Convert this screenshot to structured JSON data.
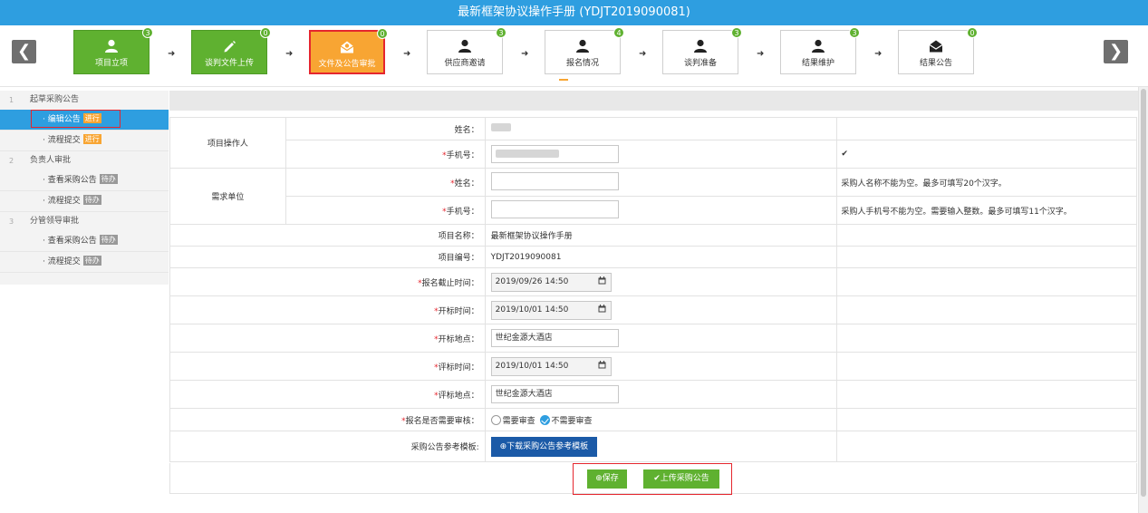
{
  "title": "最新框架协议操作手册 (YDJT2019090081)",
  "steps": [
    {
      "label": "项目立项",
      "count": "3",
      "icon": "user-icon",
      "state": "done"
    },
    {
      "label": "谈判文件上传",
      "count": "0",
      "icon": "pencil-icon",
      "state": "done"
    },
    {
      "label": "文件及公告审批",
      "count": "0",
      "icon": "envelope-open-icon",
      "state": "current"
    },
    {
      "label": "供应商邀请",
      "count": "3",
      "icon": "user-icon",
      "state": "todo"
    },
    {
      "label": "报名情况",
      "count": "4",
      "icon": "user-icon",
      "state": "todo"
    },
    {
      "label": "谈判准备",
      "count": "3",
      "icon": "user-icon",
      "state": "todo"
    },
    {
      "label": "结果维护",
      "count": "3",
      "icon": "user-icon",
      "state": "todo"
    },
    {
      "label": "结果公告",
      "count": "0",
      "icon": "envelope-icon",
      "state": "todo"
    }
  ],
  "sidebar": [
    {
      "num": "1",
      "label": "起草采购公告",
      "items": [
        {
          "label": "· 编辑公告",
          "status": "进行",
          "active": true
        },
        {
          "label": "· 流程提交",
          "status": "进行",
          "active": false
        }
      ]
    },
    {
      "num": "2",
      "label": "负责人审批",
      "items": [
        {
          "label": "· 查看采购公告",
          "status": "待办",
          "active": false
        },
        {
          "label": "· 流程提交",
          "status": "待办",
          "active": false
        }
      ]
    },
    {
      "num": "3",
      "label": "分管领导审批",
      "items": [
        {
          "label": "· 查看采购公告",
          "status": "待办",
          "active": false
        },
        {
          "label": "· 流程提交",
          "status": "待办",
          "active": false
        }
      ]
    }
  ],
  "form": {
    "operator_group": "项目操作人",
    "name_label": "姓名：",
    "phone_label": "手机号：",
    "phone_ok_mark": "✔",
    "demand_group": "需求单位",
    "demand_name_label": "姓名：",
    "demand_name_tip": "采购人名称不能为空。最多可填写20个汉字。",
    "demand_phone_label": "手机号：",
    "demand_phone_tip": "采购人手机号不能为空。需要输入整数。最多可填写11个汉字。",
    "project_name_label": "项目名称：",
    "project_name": "最新框架协议操作手册",
    "project_no_label": "项目编号：",
    "project_no": "YDJT2019090081",
    "signup_deadline_label": "报名截止时间：",
    "signup_deadline": "2019/09/26 14:50",
    "open_time_label": "开标时间：",
    "open_time": "2019/10/01 14:50",
    "open_place_label": "开标地点：",
    "open_place": "世纪金源大酒店",
    "eval_time_label": "评标时间：",
    "eval_time": "2019/10/01 14:50",
    "eval_place_label": "评标地点：",
    "eval_place": "世纪金源大酒店",
    "review_label": "报名是否需要审核：",
    "review_opt_yes": "需要审查",
    "review_opt_no": "不需要审查",
    "template_label": "采购公告参考模板:",
    "template_btn": "⊕下载采购公告参考模板"
  },
  "actions": {
    "save": "⊕保存",
    "upload": "✔上传采购公告"
  }
}
